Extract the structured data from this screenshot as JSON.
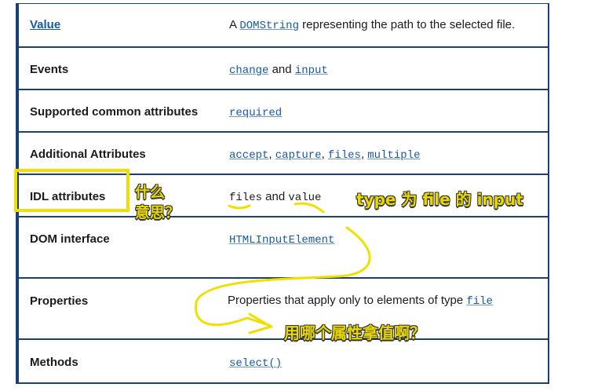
{
  "rows": [
    {
      "label": "Value",
      "parts": [
        {
          "t": "A "
        },
        {
          "t": "DOMString",
          "code": true,
          "link": true
        },
        {
          "t": " representing the path to the selected file."
        }
      ]
    },
    {
      "label": "Events",
      "parts": [
        {
          "t": "change",
          "code": true,
          "link": true
        },
        {
          "t": " and "
        },
        {
          "t": "input",
          "code": true,
          "link": true
        }
      ]
    },
    {
      "label": "Supported common attributes",
      "parts": [
        {
          "t": "required",
          "code": true,
          "link": true
        }
      ]
    },
    {
      "label": "Additional Attributes",
      "parts": [
        {
          "t": "accept",
          "code": true,
          "link": true
        },
        {
          "t": ", "
        },
        {
          "t": "capture",
          "code": true,
          "link": true
        },
        {
          "t": ", "
        },
        {
          "t": "files",
          "code": true,
          "link": true
        },
        {
          "t": ", "
        },
        {
          "t": "multiple",
          "code": true,
          "link": true
        }
      ]
    },
    {
      "label": "IDL attributes",
      "parts": [
        {
          "t": "files",
          "code": true
        },
        {
          "t": " and "
        },
        {
          "t": "value",
          "code": true
        }
      ]
    },
    {
      "label": "DOM interface",
      "parts": [
        {
          "t": "HTMLInputElement",
          "code": true,
          "link": true
        }
      ]
    },
    {
      "label": "Properties",
      "parts": [
        {
          "t": "Properties that apply only to elements of type ",
          "link": true
        },
        {
          "t": "file",
          "code": true,
          "link": true
        }
      ]
    },
    {
      "label": "Methods",
      "parts": [
        {
          "t": "select()",
          "code": true,
          "link": true
        }
      ]
    }
  ],
  "annotations": {
    "what_meaning": "什么\n意思？",
    "type_file": "type 为 file 的 input",
    "which_attr": "用哪个属性拿值啊？"
  },
  "colors": {
    "border": "#1c3f73",
    "link": "#1659a8",
    "highlight": "#f0e000"
  }
}
